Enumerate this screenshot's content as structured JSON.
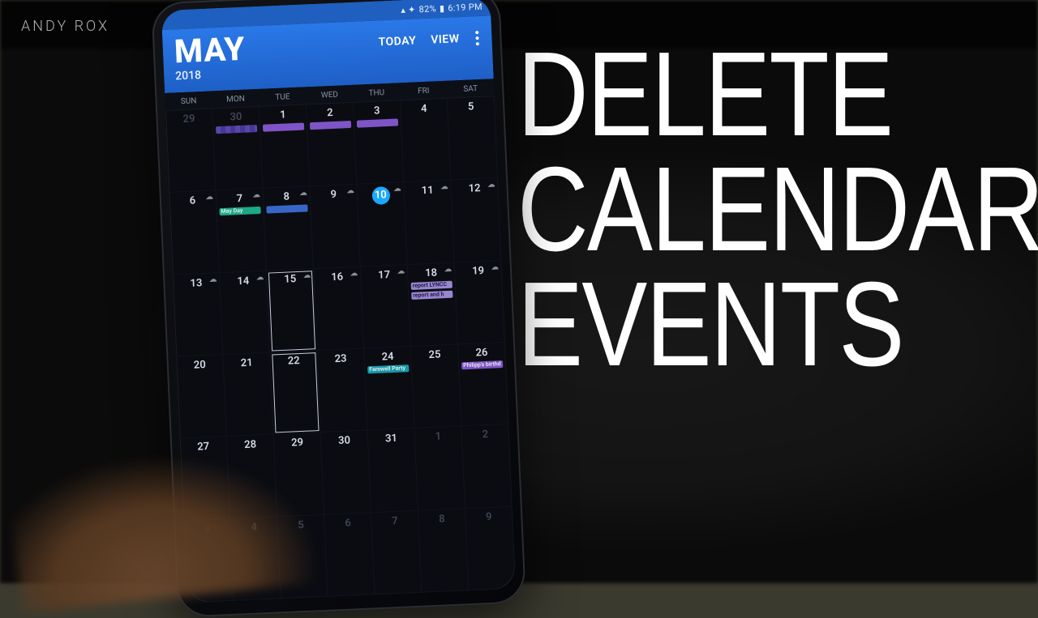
{
  "watermark": "ANDY ROX",
  "headline": {
    "l1": "DELETE",
    "l2": "CALENDAR",
    "l3": "EVENTS"
  },
  "status": {
    "battery_pct": "82%",
    "time": "6:19 PM"
  },
  "appbar": {
    "month": "MAY",
    "year": "2018",
    "today_label": "TODAY",
    "view_label": "VIEW"
  },
  "dow": [
    "SUN",
    "MON",
    "TUE",
    "WED",
    "THU",
    "FRI",
    "SAT"
  ],
  "calendar": {
    "today": 10,
    "selected_range": [
      15,
      22
    ],
    "weeks": [
      [
        {
          "n": 29,
          "dim": true
        },
        {
          "n": 30,
          "dim": true,
          "events": [
            {
              "cls": "strip",
              "label": ""
            }
          ]
        },
        {
          "n": 1,
          "events": [
            {
              "cls": "purple",
              "label": ""
            }
          ]
        },
        {
          "n": 2,
          "events": [
            {
              "cls": "purple",
              "label": ""
            }
          ]
        },
        {
          "n": 3,
          "events": [
            {
              "cls": "purple",
              "label": ""
            }
          ]
        },
        {
          "n": 4
        },
        {
          "n": 5
        }
      ],
      [
        {
          "n": 6,
          "weather": "☁"
        },
        {
          "n": 7,
          "weather": "☁",
          "events": [
            {
              "cls": "green",
              "label": "May Day"
            }
          ]
        },
        {
          "n": 8,
          "weather": "☁",
          "events": [
            {
              "cls": "blue",
              "label": ""
            }
          ]
        },
        {
          "n": 9,
          "weather": "☁"
        },
        {
          "n": 10,
          "weather": "☁"
        },
        {
          "n": 11,
          "weather": "☁"
        },
        {
          "n": 12,
          "weather": "☁"
        }
      ],
      [
        {
          "n": 13,
          "weather": "☁"
        },
        {
          "n": 14,
          "weather": "☁"
        },
        {
          "n": 15,
          "weather": "☁"
        },
        {
          "n": 16,
          "weather": "☁"
        },
        {
          "n": 17,
          "weather": "☁"
        },
        {
          "n": 18,
          "weather": "☁",
          "events": [
            {
              "cls": "lav",
              "label": "report LYNCC"
            },
            {
              "cls": "lav",
              "label": "report and h"
            }
          ]
        },
        {
          "n": 19,
          "weather": "☁"
        }
      ],
      [
        {
          "n": 20
        },
        {
          "n": 21
        },
        {
          "n": 22
        },
        {
          "n": 23
        },
        {
          "n": 24,
          "events": [
            {
              "cls": "teal",
              "label": "Farewell Party"
            }
          ]
        },
        {
          "n": 25
        },
        {
          "n": 26,
          "events": [
            {
              "cls": "purple",
              "label": "Philipp's birthd"
            }
          ]
        }
      ],
      [
        {
          "n": 27
        },
        {
          "n": 28
        },
        {
          "n": 29
        },
        {
          "n": 30
        },
        {
          "n": 31
        },
        {
          "n": 1,
          "dim": true
        },
        {
          "n": 2,
          "dim": true
        }
      ],
      [
        {
          "n": 3,
          "dim": true
        },
        {
          "n": 4,
          "dim": true
        },
        {
          "n": 5,
          "dim": true
        },
        {
          "n": 6,
          "dim": true
        },
        {
          "n": 7,
          "dim": true
        },
        {
          "n": 8,
          "dim": true
        },
        {
          "n": 9,
          "dim": true
        }
      ]
    ]
  }
}
